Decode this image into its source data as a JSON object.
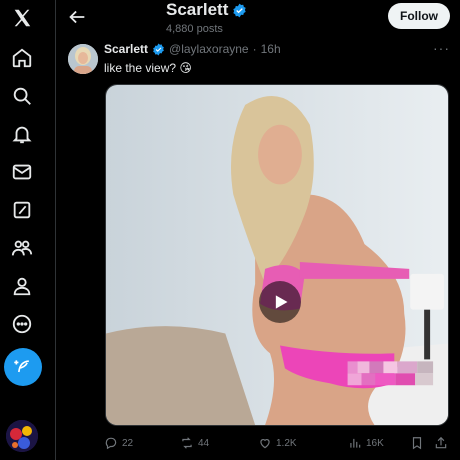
{
  "nav": {
    "items": [
      {
        "name": "x-logo-icon"
      },
      {
        "name": "home-icon"
      },
      {
        "name": "search-icon"
      },
      {
        "name": "notifications-icon"
      },
      {
        "name": "messages-icon"
      },
      {
        "name": "grok-icon"
      },
      {
        "name": "communities-icon"
      },
      {
        "name": "profile-icon"
      },
      {
        "name": "more-icon"
      }
    ],
    "compose_icon": "feather-plus-icon",
    "accent": "#1d9bf0"
  },
  "header": {
    "title": "Scarlett",
    "post_count": "4,880 posts",
    "follow_label": "Follow"
  },
  "tweet": {
    "author": "Scarlett",
    "handle": "@laylaxorayne",
    "separator": "·",
    "time": "16h",
    "text": "like the view? 😘",
    "more": "···",
    "media": {
      "type": "video",
      "play_icon": "play-icon"
    },
    "stats": {
      "replies": "22",
      "reposts": "44",
      "likes": "1.2K",
      "views": "16K"
    }
  },
  "colors": {
    "background": "#000000",
    "text": "#e7e9ea",
    "muted": "#71767b",
    "verified": "#1d9bf0"
  }
}
